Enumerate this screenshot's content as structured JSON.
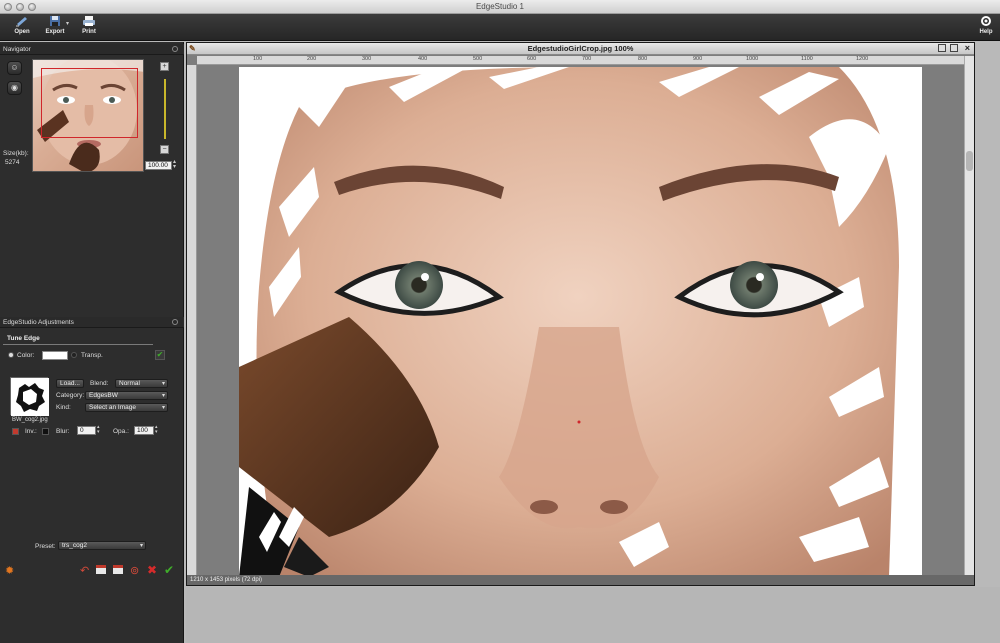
{
  "window": {
    "title": "EdgeStudio 1"
  },
  "toolbar": {
    "open_label": "Open",
    "export_label": "Export",
    "print_label": "Print",
    "help_label": "Help"
  },
  "navigator": {
    "title": "Navigator",
    "size_label": "Size(kb):",
    "size_value": "5274",
    "zoom_value": "100.00",
    "plus_label": "+",
    "minus_label": "−"
  },
  "adjustments": {
    "title": "EdgeStudio Adjustments",
    "tab_label": "Tune Edge",
    "color_label": "Color:",
    "transp_label": "Transp.",
    "load_label": "Load...",
    "blend_label": "Blend:",
    "blend_value": "Normal",
    "category_label": "Category:",
    "category_value": "EdgesBW",
    "kind_label": "Kind:",
    "kind_value": "Select an Image",
    "thumb_caption": "BW_cog2.jpg",
    "inv_label": "Inv.:",
    "blur_label": "Blur:",
    "blur_value": "0",
    "opa_label": "Opa.:",
    "opa_value": "100",
    "preset_label": "Preset:",
    "preset_value": "trs_cog2"
  },
  "editor": {
    "title": "EdgestudioGirlCrop.jpg 100%",
    "status": "1210 x 1453 pixels (72 dpi)",
    "ruler_ticks": [
      "100",
      "200",
      "300",
      "400",
      "500",
      "600",
      "700",
      "800",
      "900",
      "1000",
      "1100",
      "1200"
    ]
  },
  "colors": {
    "accent_yellow": "#c9b72b",
    "nav_rect": "#d0262b",
    "confirm_green": "#3fae2a",
    "cancel_red": "#d62b2b"
  }
}
